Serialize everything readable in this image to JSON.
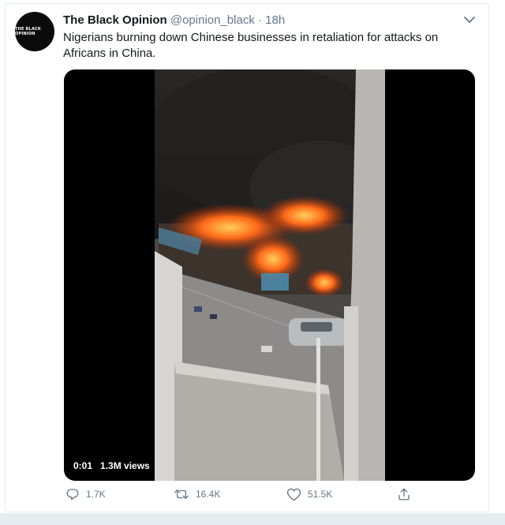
{
  "tweet": {
    "author": {
      "display_name": "The Black Opinion",
      "handle": "@opinion_black",
      "avatar_text": "THE BLACK OPINION"
    },
    "separator": "·",
    "time": "18h",
    "text": "Nigerians burning down Chinese businesses in retaliation for attacks on Africans in China.",
    "media": {
      "type": "video",
      "time_label": "0:01",
      "views_label": "1.3M views"
    },
    "actions": {
      "reply_count": "1.7K",
      "retweet_count": "16.4K",
      "like_count": "51.5K"
    }
  },
  "icons": [
    "chevron-down-icon",
    "reply-icon",
    "retweet-icon",
    "like-icon",
    "share-icon"
  ],
  "colors": {
    "text_primary": "#14171a",
    "text_secondary": "#657786",
    "border": "#e6ecf0",
    "video_background": "#000000"
  }
}
